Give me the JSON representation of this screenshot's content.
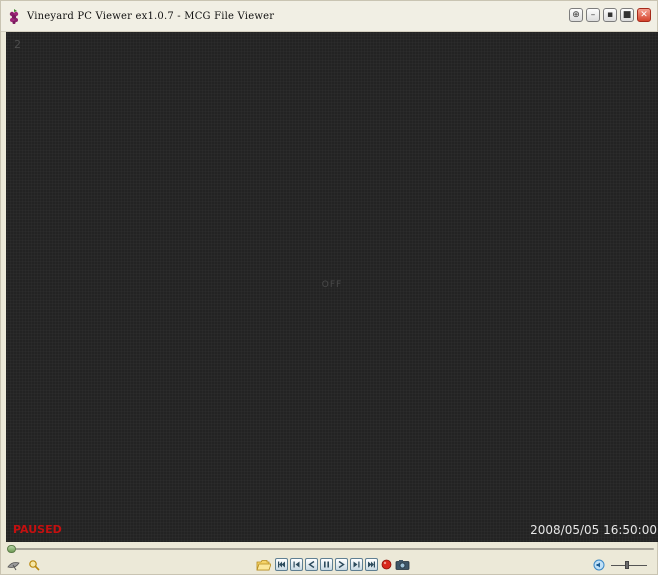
{
  "window": {
    "title": "Vineyard PC Viewer ex1.0.7 - MCG File Viewer"
  },
  "title_controls": [
    {
      "name": "network-button",
      "glyph": "⊕"
    },
    {
      "name": "minimize-button",
      "glyph": "–"
    },
    {
      "name": "restore-button",
      "glyph": "▪"
    },
    {
      "name": "maximize-button",
      "glyph": "■"
    },
    {
      "name": "close-button",
      "glyph": "✕"
    }
  ],
  "viewport": {
    "channel_number": "2",
    "signal_text": "OFF",
    "status": "PAUSED",
    "timestamp": "2008/05/05 16:50:00"
  },
  "seek": {
    "position_fraction": 0.0
  },
  "toolbar": {
    "left_icons": [
      "satellite-dish-icon",
      "magnifier-icon"
    ],
    "transport_buttons": [
      "open-folder-icon",
      "skip-to-start-icon",
      "previous-frame-icon",
      "rewind-icon",
      "pause-icon",
      "play-icon",
      "next-frame-icon",
      "skip-to-end-icon",
      "record-icon",
      "snapshot-camera-icon"
    ],
    "volume_level": 0.45
  },
  "colors": {
    "viewport_bg": "#232323",
    "status_red": "#c41010",
    "timestamp_text": "#e6e6e6",
    "chrome": "#ece9d8"
  }
}
